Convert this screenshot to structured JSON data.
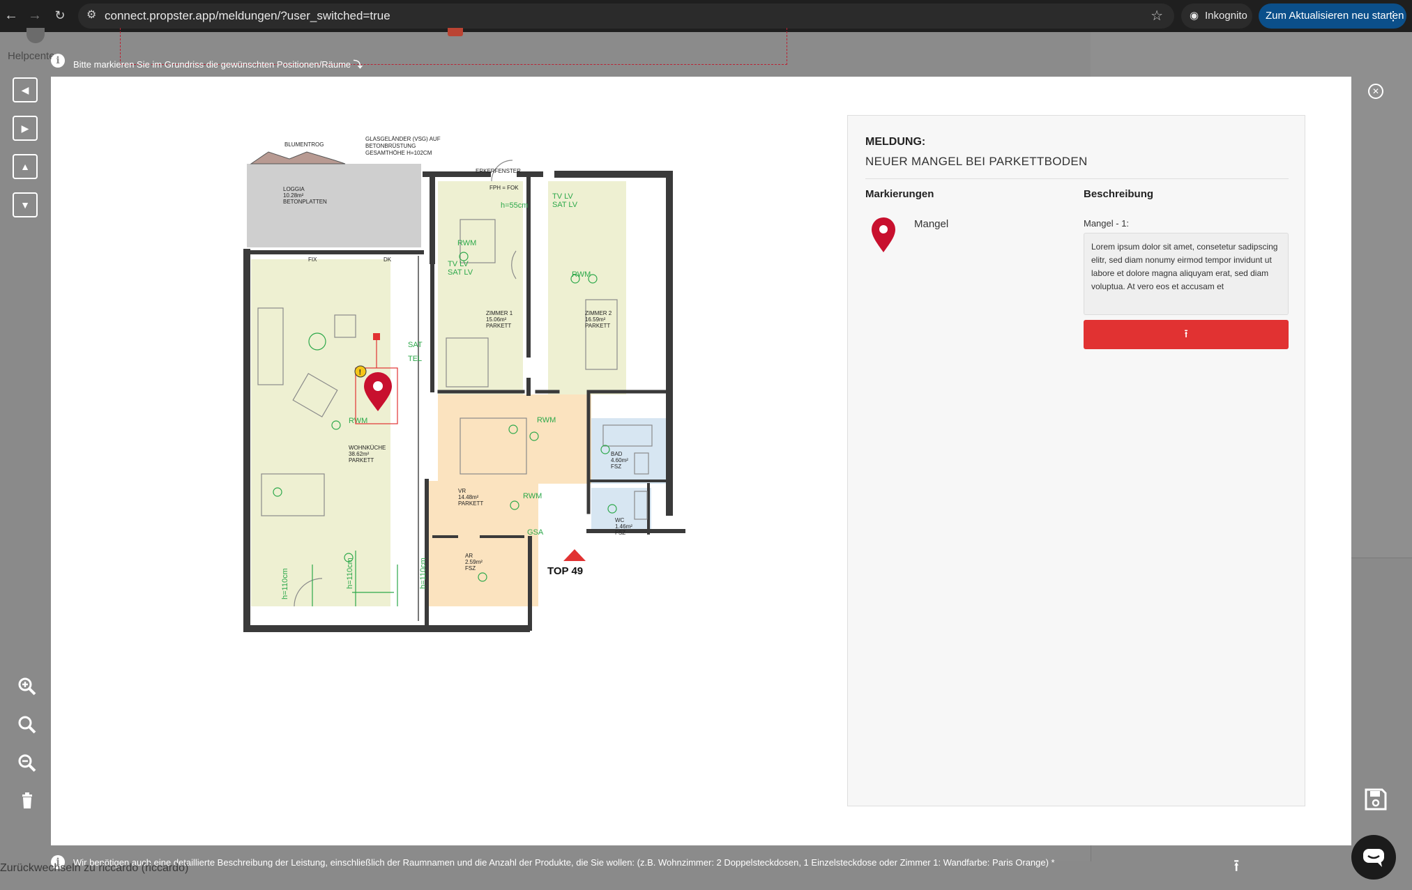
{
  "browser": {
    "url": "connect.propster.app/meldungen/?user_switched=true",
    "incognito_label": "Inkognito",
    "update_label": "Zum Aktualisieren neu starten"
  },
  "backdrop": {
    "helpcenter_label": "Helpcenter",
    "hint_top": "Bitte markieren Sie im Grundriss die gewünschten Positionen/Räume",
    "hint_bottom": "Wir benötigen auch eine detaillierte Beschreibung der Leistung, einschließlich der Raumnamen und die Anzahl der Produkte, die Sie wollen: (z.B. Wohnzimmer: 2 Doppelsteckdosen, 1 Einzelsteckdose oder Zimmer 1: Wandfarbe: Paris Orange) *",
    "switch_back": "Zurückwechseln zu riccardo (riccardo)"
  },
  "colors": {
    "accent_red": "#e13232",
    "pin_red": "#c8102e",
    "chat_bg": "#1b1b1b",
    "update_blue": "#0b4f8a"
  },
  "toolbar": {
    "icons": [
      "arrow-left-icon",
      "arrow-right-icon",
      "arrow-up-icon",
      "arrow-down-icon",
      "zoom-in-icon",
      "zoom-reset-icon",
      "zoom-out-icon",
      "trash-icon"
    ]
  },
  "panel": {
    "label": "MELDUNG:",
    "title": "NEUER MANGEL BEI PARKETTBODEN",
    "col_markers": "Markierungen",
    "col_description": "Beschreibung",
    "marker_name": "Mangel",
    "marker_label": "Mangel - 1:",
    "description": "Lorem ipsum dolor sit amet, consetetur sadipscing elitr, sed diam nonumy eirmod tempor invidunt ut labore et dolore magna aliquyam erat, sed diam voluptua. At vero eos et accusam et"
  },
  "plan": {
    "top_label": "TOP 49",
    "rooms": [
      {
        "name": "LOGGIA",
        "area": "10.28m²",
        "floor": "BETONPLATTEN"
      },
      {
        "name": "ZIMMER 1",
        "area": "15.06m²",
        "floor": "PARKETT"
      },
      {
        "name": "ZIMMER 2",
        "area": "16.59m²",
        "floor": "PARKETT"
      },
      {
        "name": "WOHNKÜCHE",
        "area": "38.62m²",
        "floor": "PARKETT"
      },
      {
        "name": "BAD",
        "area": "4.60m²",
        "floor": "FSZ"
      },
      {
        "name": "VR",
        "area": "14.48m²",
        "floor": "PARKETT"
      },
      {
        "name": "WC",
        "area": "1.46m²",
        "floor": "FSZ"
      },
      {
        "name": "AR",
        "area": "2.59m²",
        "floor": "FSZ"
      }
    ],
    "labels": {
      "blumentrog": "BLUMENTROG",
      "glasgelaender": "GLASGELÄNDER (VSG) AUF",
      "betonbruestung": "BETONBRÜSTUNG",
      "gesamthoehe": "GESAMTHÖHE H=102CM",
      "erkerfenster": "ERKERFENSTER",
      "fph": "FPH = FOK",
      "h55": "h=55cm",
      "rwm": "RWM",
      "tvlv": "TV LV",
      "satlv": "SAT LV",
      "fix": "FIX",
      "dk": "DK",
      "sat": "SAT",
      "tel": "TEL",
      "gsa": "GSA",
      "h110": "h=110cm",
      "warning": "!"
    }
  }
}
